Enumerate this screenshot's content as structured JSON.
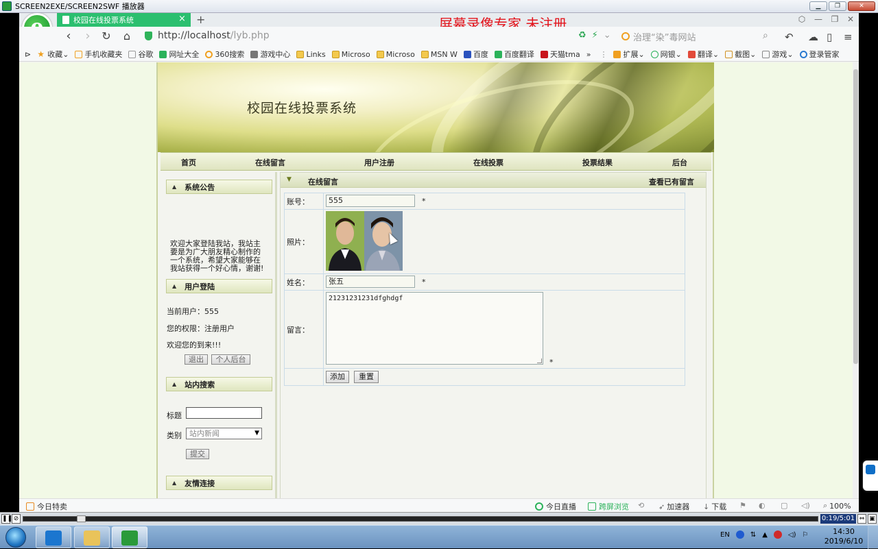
{
  "player": {
    "title": "SCREEN2EXE/SCREEN2SWF 播放器",
    "time": "0:19/5:01"
  },
  "browser": {
    "tab_title": "校园在线投票系统",
    "tab_close": "×",
    "new_tab": "+",
    "watermark": "屏幕录像专家  未注册",
    "url_host": "http://localhost",
    "url_path": "/lyb.php",
    "search_placeholder": "治理“染”毒网站",
    "bookmarks": [
      {
        "label": "收藏",
        "icon": "star"
      },
      {
        "label": "手机收藏夹",
        "icon": "phone"
      },
      {
        "label": "谷歌",
        "icon": "page"
      },
      {
        "label": "网址大全",
        "icon": "globe"
      },
      {
        "label": "360搜索",
        "icon": "search"
      },
      {
        "label": "游戏中心",
        "icon": "game"
      },
      {
        "label": "Links",
        "icon": "folder"
      },
      {
        "label": "Microso",
        "icon": "folder"
      },
      {
        "label": "Microso",
        "icon": "folder"
      },
      {
        "label": "MSN W",
        "icon": "folder"
      },
      {
        "label": "百度",
        "icon": "baidu"
      },
      {
        "label": "百度翻译",
        "icon": "translate"
      },
      {
        "label": "天猫tma",
        "icon": "tmall"
      }
    ],
    "bookmark_more": "»",
    "tools": [
      {
        "label": "扩展"
      },
      {
        "label": "网银"
      },
      {
        "label": "翻译"
      },
      {
        "label": "截图"
      },
      {
        "label": "游戏"
      },
      {
        "label": "登录管家"
      }
    ],
    "status": {
      "left": "今日特卖",
      "live": "今日直播",
      "cross_screen": "跨屏浏览",
      "accelerator": "加速器",
      "download": "下载",
      "zoom": "100%"
    }
  },
  "site": {
    "title": "校园在线投票系统",
    "nav": [
      "首页",
      "在线留言",
      "用户注册",
      "在线投票",
      "投票结果",
      "后台"
    ],
    "notice": {
      "heading": "系统公告",
      "text": "欢迎大家登陆我站，我站主要是为广大朋友精心制作的一个系统，希望大家能够在我站获得一个好心情，谢谢!"
    },
    "login": {
      "heading": "用户登陆",
      "current_user": "当前用户：555",
      "permission": "您的权限：注册用户",
      "welcome": "欢迎您的到来!!!",
      "logout_label": "退出",
      "personal_label": "个人后台"
    },
    "search": {
      "heading": "站内搜索",
      "title_label": "标题",
      "title_value": "",
      "category_label": "类别",
      "category_value": "站内新闻",
      "submit_label": "提交"
    },
    "links": {
      "heading": "友情连接"
    }
  },
  "form": {
    "heading": "在线留言",
    "view_link": "查看已有留言",
    "account_label": "账号：",
    "account_value": "555",
    "photo_label": "照片：",
    "name_label": "姓名：",
    "name_value": "张五",
    "message_label": "留言：",
    "message_value": "21231231231dfghdgf",
    "required_mark": "*",
    "add_label": "添加",
    "reset_label": "重置"
  },
  "taskbar": {
    "lang": "EN",
    "time": "14:30",
    "date": "2019/6/10"
  }
}
